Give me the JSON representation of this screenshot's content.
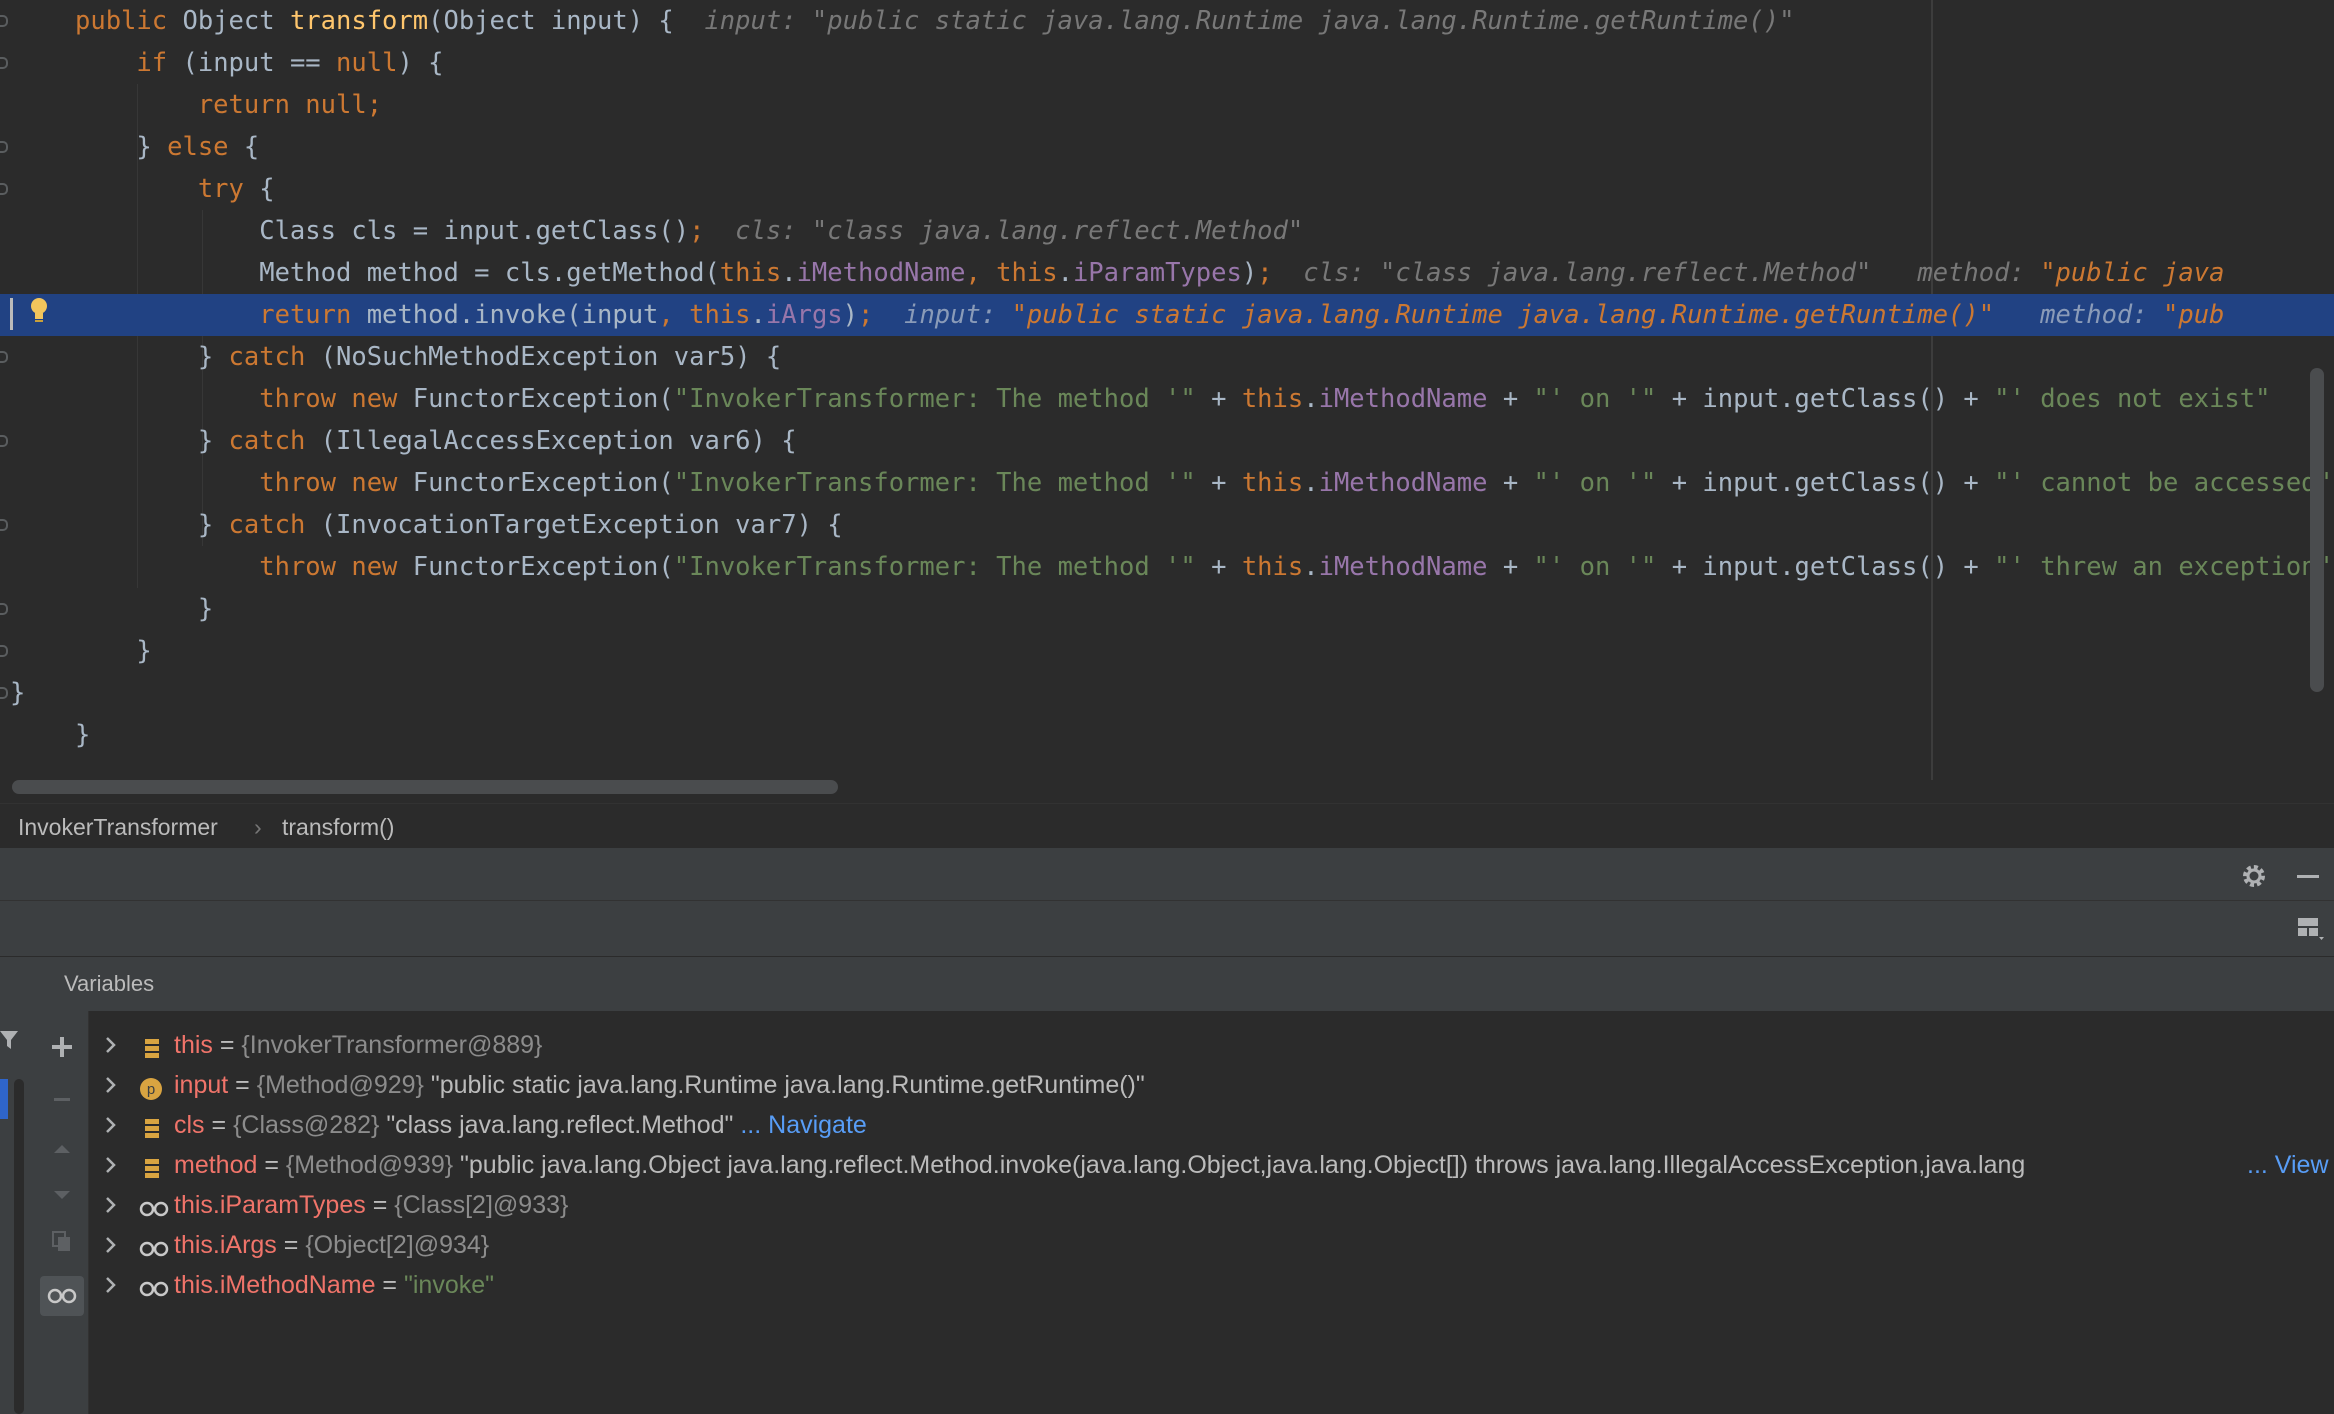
{
  "editor": {
    "lines": [
      {
        "segments": [
          [
            "kw",
            "public "
          ],
          [
            "",
            "Object "
          ],
          [
            "fn",
            "transform"
          ],
          [
            "",
            "(Object input) {  "
          ],
          [
            "hint",
            "input: \"public static java.lang.Runtime java.lang.Runtime.getRuntime()\""
          ]
        ]
      },
      {
        "segments": [
          [
            "",
            "    "
          ],
          [
            "kw",
            "if "
          ],
          [
            "",
            "(input "
          ],
          [
            "",
            "== "
          ],
          [
            "kw",
            "null"
          ],
          [
            "",
            ") {"
          ]
        ]
      },
      {
        "segments": [
          [
            "",
            "        "
          ],
          [
            "kw",
            "return null;"
          ]
        ]
      },
      {
        "segments": [
          [
            "",
            "    } "
          ],
          [
            "kw",
            "else "
          ],
          [
            "",
            "{"
          ]
        ]
      },
      {
        "segments": [
          [
            "",
            "        "
          ],
          [
            "kw",
            "try "
          ],
          [
            "",
            "{"
          ]
        ]
      },
      {
        "segments": [
          [
            "",
            "            Class cls = input.getClass()"
          ],
          [
            "kw",
            ";"
          ],
          [
            "",
            "  "
          ],
          [
            "hint",
            "cls: \"class java.lang.reflect.Method\""
          ]
        ]
      },
      {
        "segments": [
          [
            "",
            "            Method method = cls.getMethod("
          ],
          [
            "kw",
            "this"
          ],
          [
            "",
            "."
          ],
          [
            "fld",
            "iMethodName"
          ],
          [
            "kw",
            ", this"
          ],
          [
            "",
            "."
          ],
          [
            "fld",
            "iParamTypes"
          ],
          [
            "",
            ")"
          ],
          [
            "kw",
            ";"
          ],
          [
            "",
            "  "
          ],
          [
            "hint",
            "cls: \"class java.lang.reflect.Method\"   method: "
          ],
          [
            "hintv",
            "\"public java"
          ]
        ]
      },
      {
        "segments": [
          [
            "",
            "            "
          ],
          [
            "kw",
            "return "
          ],
          [
            "",
            "method.invoke(input"
          ],
          [
            "kw",
            ", this"
          ],
          [
            "",
            "."
          ],
          [
            "fld",
            "iArgs"
          ],
          [
            "",
            ")"
          ],
          [
            "kw",
            ";"
          ],
          [
            "",
            "  "
          ],
          [
            "hint",
            "input: "
          ],
          [
            "hintv",
            "\"public static java.lang.Runtime java.lang.Runtime.getRuntime()\""
          ],
          [
            "hint",
            "   method: "
          ],
          [
            "hintv",
            "\"pub"
          ]
        ]
      },
      {
        "segments": [
          [
            "",
            "        } "
          ],
          [
            "kw",
            "catch "
          ],
          [
            "",
            "(NoSuchMethodException var5) {"
          ]
        ]
      },
      {
        "segments": [
          [
            "",
            "            "
          ],
          [
            "kw",
            "throw new "
          ],
          [
            "",
            "FunctorException("
          ],
          [
            "str",
            "\"InvokerTransformer: The method '\""
          ],
          [
            "",
            " + "
          ],
          [
            "kw",
            "this"
          ],
          [
            "",
            "."
          ],
          [
            "fld",
            "iMethodName"
          ],
          [
            "",
            " + "
          ],
          [
            "str",
            "\"' on '\""
          ],
          [
            "",
            " + input.getClass() + "
          ],
          [
            "str",
            "\"' does not exist\""
          ]
        ]
      },
      {
        "segments": [
          [
            "",
            "        } "
          ],
          [
            "kw",
            "catch "
          ],
          [
            "",
            "(IllegalAccessException var6) {"
          ]
        ]
      },
      {
        "segments": [
          [
            "",
            "            "
          ],
          [
            "kw",
            "throw new "
          ],
          [
            "",
            "FunctorException("
          ],
          [
            "str",
            "\"InvokerTransformer: The method '\""
          ],
          [
            "",
            " + "
          ],
          [
            "kw",
            "this"
          ],
          [
            "",
            "."
          ],
          [
            "fld",
            "iMethodName"
          ],
          [
            "",
            " + "
          ],
          [
            "str",
            "\"' on '\""
          ],
          [
            "",
            " + input.getClass() + "
          ],
          [
            "str",
            "\"' cannot be accessed\""
          ]
        ]
      },
      {
        "segments": [
          [
            "",
            "        } "
          ],
          [
            "kw",
            "catch "
          ],
          [
            "",
            "(InvocationTargetException var7) {"
          ]
        ]
      },
      {
        "segments": [
          [
            "",
            "            "
          ],
          [
            "kw",
            "throw new "
          ],
          [
            "",
            "FunctorException("
          ],
          [
            "str",
            "\"InvokerTransformer: The method '\""
          ],
          [
            "",
            " + "
          ],
          [
            "kw",
            "this"
          ],
          [
            "",
            "."
          ],
          [
            "fld",
            "iMethodName"
          ],
          [
            "",
            " + "
          ],
          [
            "str",
            "\"' on '\""
          ],
          [
            "",
            " + input.getClass() + "
          ],
          [
            "str",
            "\"' threw an exception\""
          ]
        ]
      },
      {
        "segments": [
          [
            "",
            "        }"
          ]
        ]
      },
      {
        "segments": [
          [
            "",
            "    }"
          ]
        ]
      },
      {
        "segments": [
          [
            "",
            "}"
          ]
        ]
      },
      {
        "segments": [
          [
            "",
            "}"
          ]
        ]
      }
    ],
    "current_line_index": 7
  },
  "breadcrumb": {
    "class_name": "InvokerTransformer",
    "separator": "›",
    "method_name": "transform()"
  },
  "variables_panel": {
    "title": "Variables",
    "rows": [
      {
        "icon": "field-icon",
        "name": "this",
        "eq": " = ",
        "type": "{InvokerTransformer@889}",
        "value": "",
        "link": ""
      },
      {
        "icon": "parameter-icon",
        "name": "input",
        "eq": " = ",
        "type": "{Method@929} ",
        "value": "\"public static java.lang.Runtime java.lang.Runtime.getRuntime()\"",
        "link": ""
      },
      {
        "icon": "field-icon",
        "name": "cls",
        "eq": " = ",
        "type": "{Class@282} ",
        "value": "\"class java.lang.reflect.Method\"",
        "link": " ... Navigate"
      },
      {
        "icon": "field-icon",
        "name": "method",
        "eq": " = ",
        "type": "{Method@939} ",
        "value": "\"public java.lang.Object java.lang.reflect.Method.invoke(java.lang.Object,java.lang.Object[]) throws java.lang.IllegalAccessException,java.lang",
        "link": "... View"
      },
      {
        "icon": "watch-icon",
        "name": "this.iParamTypes",
        "eq": " = ",
        "type": "{Class[2]@933}",
        "value": "",
        "link": ""
      },
      {
        "icon": "watch-icon",
        "name": "this.iArgs",
        "eq": " = ",
        "type": "{Object[2]@934}",
        "value": "",
        "link": ""
      },
      {
        "icon": "watch-icon",
        "name": "this.iMethodName",
        "eq": " = ",
        "type": "",
        "value": "",
        "string": "\"invoke\"",
        "link": ""
      }
    ]
  },
  "colors": {
    "editor_bg": "#2b2b2b",
    "current_line": "#214283",
    "keyword": "#cc7832",
    "field": "#9876aa",
    "string": "#6a8759",
    "method_decl": "#ffc66d",
    "variable_name": "#f0746a",
    "link": "#589df6"
  }
}
